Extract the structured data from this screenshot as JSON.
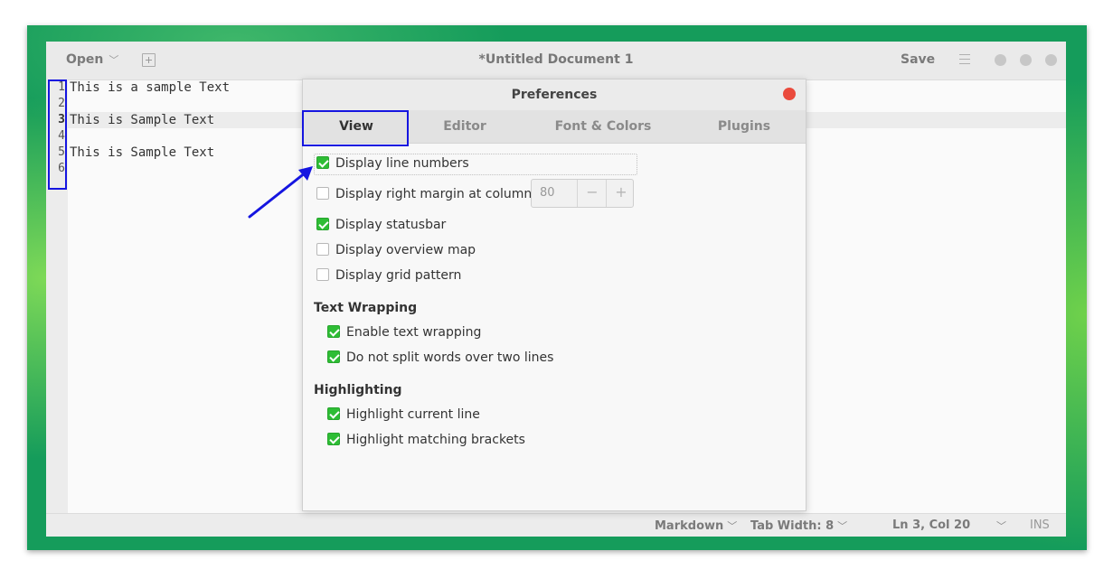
{
  "window": {
    "open_label": "Open",
    "title": "*Untitled Document 1",
    "save_label": "Save"
  },
  "editor": {
    "line_numbers": [
      "1",
      "2",
      "3",
      "4",
      "5",
      "6"
    ],
    "lines": [
      "This is a sample Text",
      "",
      "This is Sample Text",
      "",
      "This is Sample Text",
      ""
    ],
    "current_line": 3
  },
  "statusbar": {
    "language": "Markdown",
    "tab_width": "Tab Width: 8",
    "position": "Ln 3, Col 20",
    "mode": "INS"
  },
  "preferences": {
    "title": "Preferences",
    "tabs": [
      "View",
      "Editor",
      "Font & Colors",
      "Plugins"
    ],
    "active_tab": "View",
    "options": {
      "display_line_numbers": {
        "label": "Display line numbers",
        "checked": true
      },
      "display_right_margin": {
        "label": "Display right margin at column:",
        "checked": false
      },
      "display_statusbar": {
        "label": "Display statusbar",
        "checked": true
      },
      "display_overview_map": {
        "label": "Display overview map",
        "checked": false
      },
      "display_grid_pattern": {
        "label": "Display grid pattern",
        "checked": false
      }
    },
    "right_margin_column": "80",
    "spin_minus": "−",
    "spin_plus": "+",
    "text_wrapping": {
      "heading": "Text Wrapping",
      "enable": {
        "label": "Enable text wrapping",
        "checked": true
      },
      "no_split": {
        "label": "Do not split words over two lines",
        "checked": true
      }
    },
    "highlighting": {
      "heading": "Highlighting",
      "current_line": {
        "label": "Highlight current line",
        "checked": true
      },
      "matching_brackets": {
        "label": "Highlight matching brackets",
        "checked": true
      }
    }
  },
  "colors": {
    "annotation": "#1515e0",
    "checkbox_on": "#2ebd35",
    "close_button": "#ea4a3c",
    "desktop": "#159c5b"
  }
}
